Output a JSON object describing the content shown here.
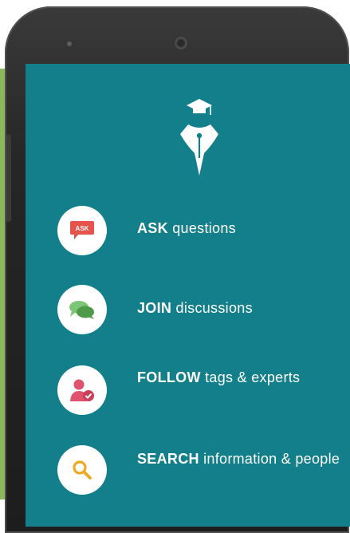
{
  "features": [
    {
      "title": "ASK",
      "description": "questions",
      "icon": "ask-speech-bubble-icon",
      "badge": "ASK"
    },
    {
      "title": "JOIN",
      "description": "discussions",
      "icon": "chat-bubbles-icon"
    },
    {
      "title": "FOLLOW",
      "description": "tags & experts",
      "icon": "follow-user-icon"
    },
    {
      "title": "SEARCH",
      "description": "information & people",
      "icon": "search-icon"
    }
  ],
  "colors": {
    "screen": "#127f8a",
    "ask_icon": "#e5534b",
    "join_icon": "#5aa855",
    "follow_icon": "#e0526d",
    "search_icon": "#f0a821"
  }
}
